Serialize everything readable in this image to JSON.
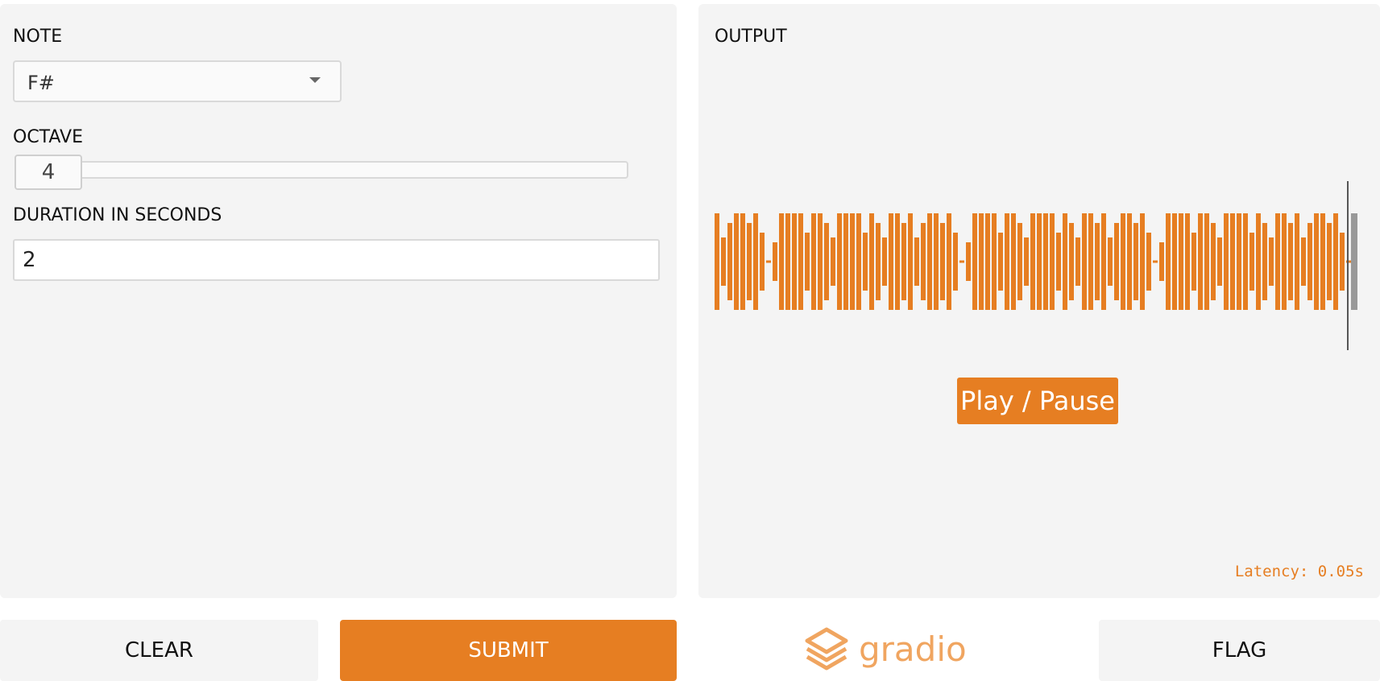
{
  "inputs": {
    "note": {
      "label": "NOTE",
      "value": "F#"
    },
    "octave": {
      "label": "OCTAVE",
      "value": "4",
      "min_position_fraction": 0
    },
    "duration": {
      "label": "DURATION IN SECONDS",
      "value": "2"
    }
  },
  "output": {
    "label": "OUTPUT",
    "play_label": "Play / Pause",
    "latency": "Latency: 0.05s",
    "waveform_color": "#e67e22",
    "playhead_color": "#555555"
  },
  "actions": {
    "clear_label": "CLEAR",
    "submit_label": "SUBMIT",
    "flag_label": "FLAG"
  },
  "logo": {
    "text": "gradio"
  },
  "colors": {
    "accent": "#e67e22",
    "panel": "#f4f4f4"
  }
}
